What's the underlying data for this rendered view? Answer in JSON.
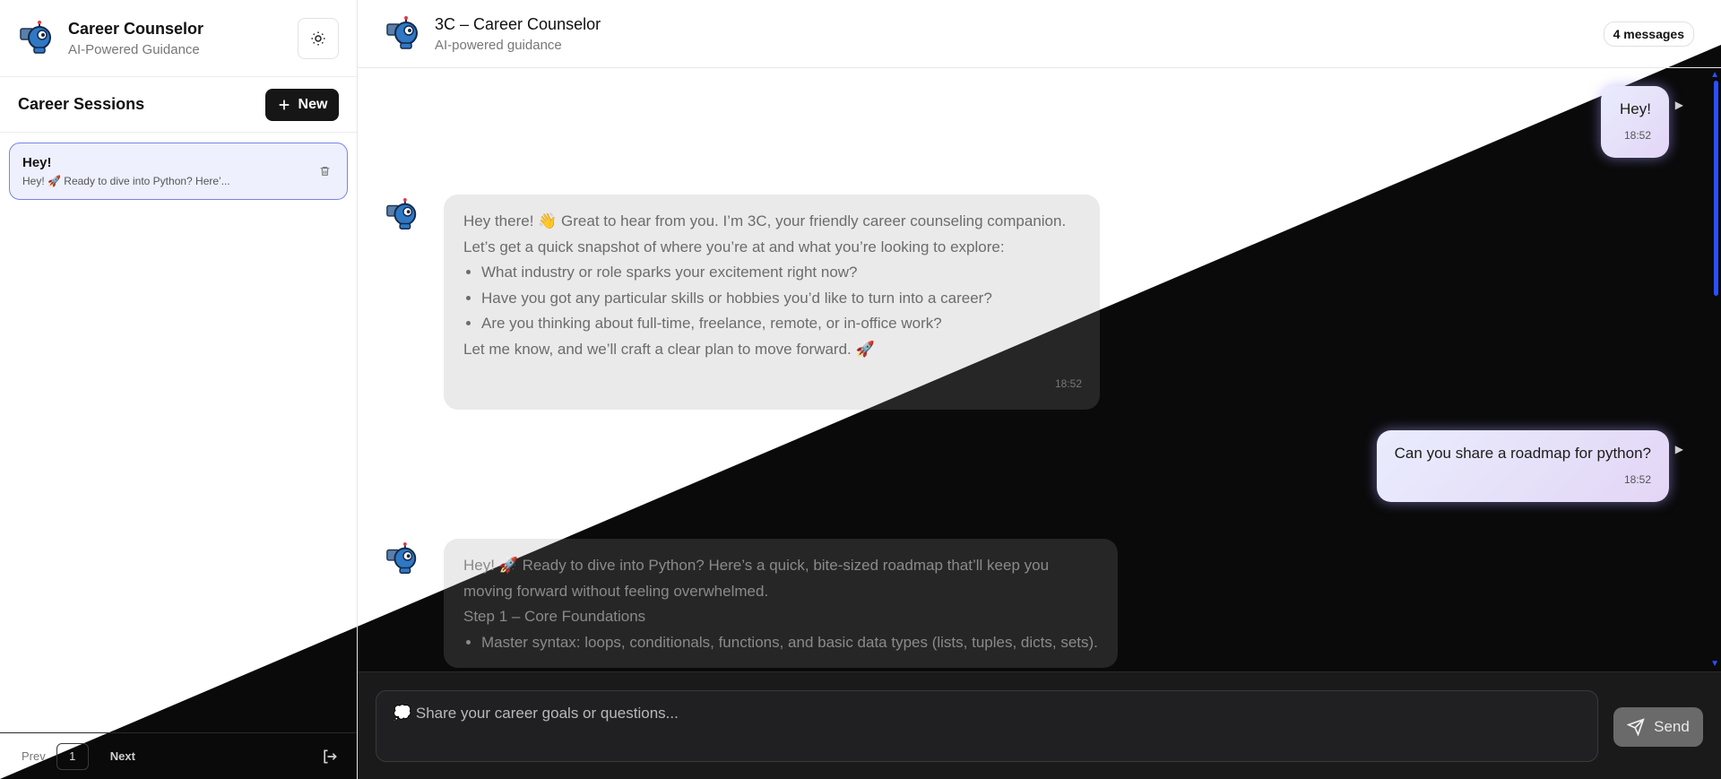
{
  "sidebar": {
    "title": "Career Counselor",
    "subtitle": "AI-Powered Guidance",
    "sessions_title": "Career Sessions",
    "new_label": "New",
    "sessions": [
      {
        "title": "Hey!",
        "preview": "Hey! 🚀 Ready to dive into Python? Here’..."
      }
    ],
    "pagination": {
      "prev": "Prev",
      "page": "1",
      "next": "Next"
    }
  },
  "header": {
    "title": "3C – Career Counselor",
    "subtitle": "AI-powered guidance",
    "message_count": "4 messages"
  },
  "messages": [
    {
      "role": "user",
      "text": "Hey!",
      "time": "18:52"
    },
    {
      "role": "assistant",
      "intro": "Hey there! 👋 Great to hear from you. I’m 3C, your friendly career counseling companion.",
      "line2": "Let’s get a quick snapshot of where you’re at and what you’re looking to explore:",
      "bullets": [
        "What industry or role sparks your excitement right now?",
        "Have you got any particular skills or hobbies you’d like to turn into a career?",
        "Are you thinking about full-time, freelance, remote, or in-office work?"
      ],
      "outro": "Let me know, and we’ll craft a clear plan to move forward. 🚀",
      "time": "18:52"
    },
    {
      "role": "user",
      "text": "Can you share a roadmap for python?",
      "time": "18:52"
    },
    {
      "role": "assistant",
      "intro": "Hey! 🚀 Ready to dive into Python? Here’s a quick, bite-sized roadmap that’ll keep you moving forward without feeling overwhelmed.",
      "step": "Step 1 – Core Foundations",
      "bullets": [
        "Master syntax: loops, conditionals, functions, and basic data types (lists, tuples, dicts, sets)."
      ]
    }
  ],
  "composer": {
    "placeholder": "💭 Share your career goals or questions...",
    "send_label": "Send"
  },
  "colors": {
    "accent": "#2b50ff",
    "new_button": "#161616",
    "session_border": "#7b83e8"
  }
}
